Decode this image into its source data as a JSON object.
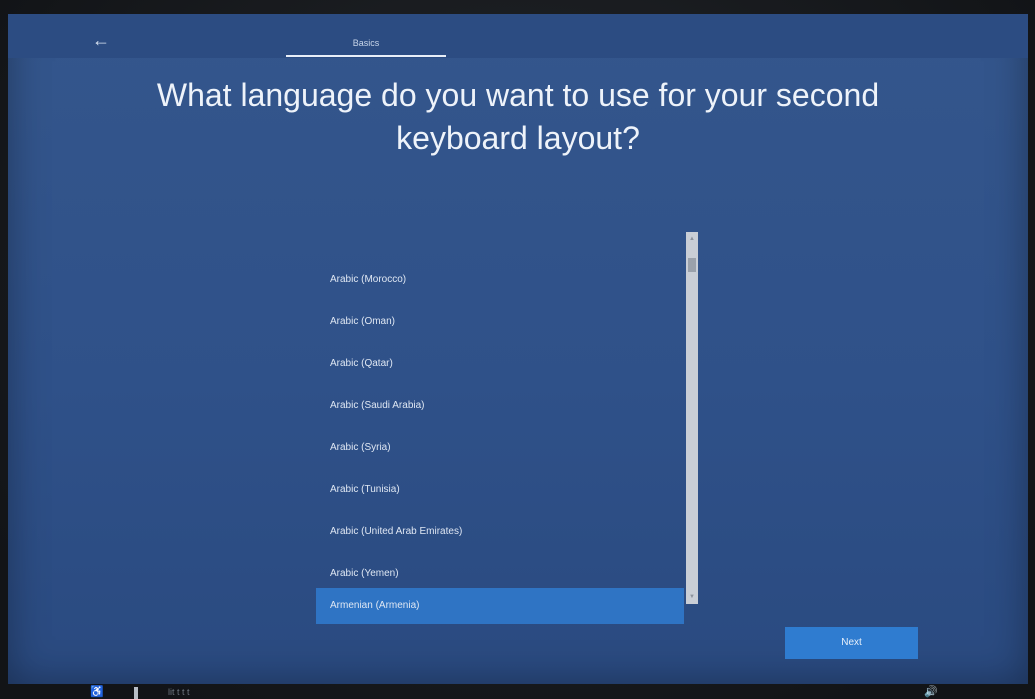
{
  "header": {
    "back_icon": "←",
    "tab_label": "Basics"
  },
  "title": "What language do you want to use for your second keyboard layout?",
  "languages": [
    {
      "label": "Arabic (Morocco)",
      "selected": false
    },
    {
      "label": "Arabic (Oman)",
      "selected": false
    },
    {
      "label": "Arabic (Qatar)",
      "selected": false
    },
    {
      "label": "Arabic (Saudi Arabia)",
      "selected": false
    },
    {
      "label": "Arabic (Syria)",
      "selected": false
    },
    {
      "label": "Arabic (Tunisia)",
      "selected": false
    },
    {
      "label": "Arabic (United Arab Emirates)",
      "selected": false
    },
    {
      "label": "Arabic (Yemen)",
      "selected": false
    },
    {
      "label": "Armenian (Armenia)",
      "selected": true
    }
  ],
  "buttons": {
    "next_label": "Next"
  },
  "icons": {
    "back": "back-arrow-icon",
    "accessibility": "accessibility-icon",
    "microphone": "microphone-icon",
    "volume": "volume-icon"
  },
  "taskbar": {
    "text": "lit t t t"
  },
  "colors": {
    "background": "#2f5189",
    "selected": "#2f74c4",
    "next_button": "#2f7cd0",
    "text": "#eef3fa"
  }
}
